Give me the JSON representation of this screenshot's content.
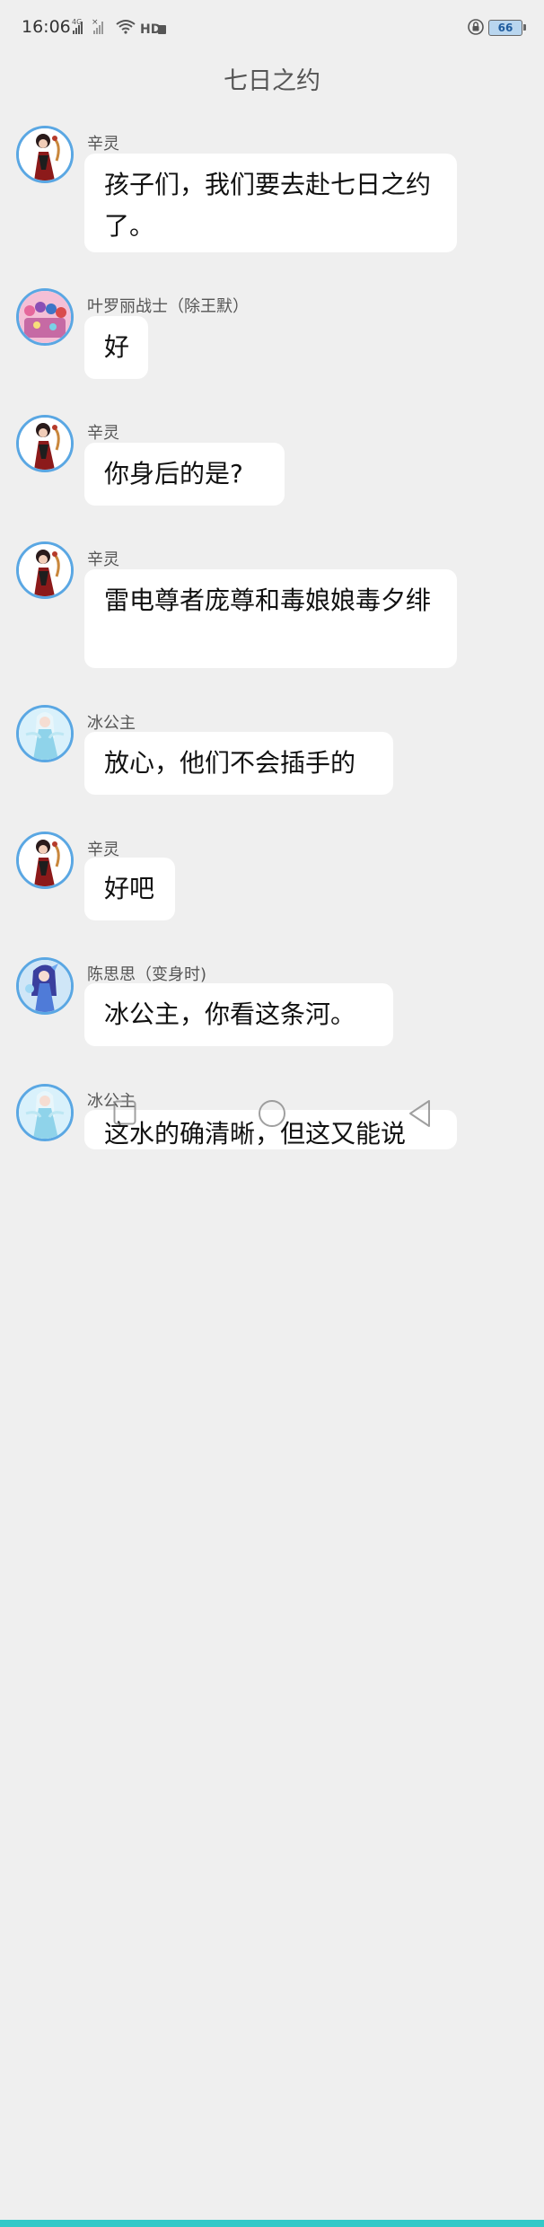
{
  "status_bar": {
    "time": "16:06",
    "battery": "66",
    "icons": [
      "4g-signal-icon",
      "signal-icon",
      "wifi-icon",
      "hd-icon",
      "lock-icon",
      "battery-icon"
    ]
  },
  "chat": {
    "title": "七日之约",
    "messages": [
      {
        "sender": "辛灵",
        "text": "孩子们，我们要去赴七日之约了。"
      },
      {
        "sender": "叶罗丽战士（除王默）",
        "text": "好"
      },
      {
        "sender": "辛灵",
        "text": "你身后的是?"
      },
      {
        "sender": "辛灵",
        "text": "雷电尊者庞尊和毒娘娘毒夕绯"
      },
      {
        "sender": "冰公主",
        "text": "放心，他们不会插手的"
      },
      {
        "sender": "辛灵",
        "text": "好吧"
      },
      {
        "sender": "陈思思（变身时)",
        "text": "冰公主，你看这条河。"
      },
      {
        "sender": "冰公主",
        "text": "这水的确清晰，但这又能说"
      }
    ]
  },
  "nav_bar": {
    "icons": [
      "recent-apps-icon",
      "home-icon",
      "back-icon"
    ]
  }
}
